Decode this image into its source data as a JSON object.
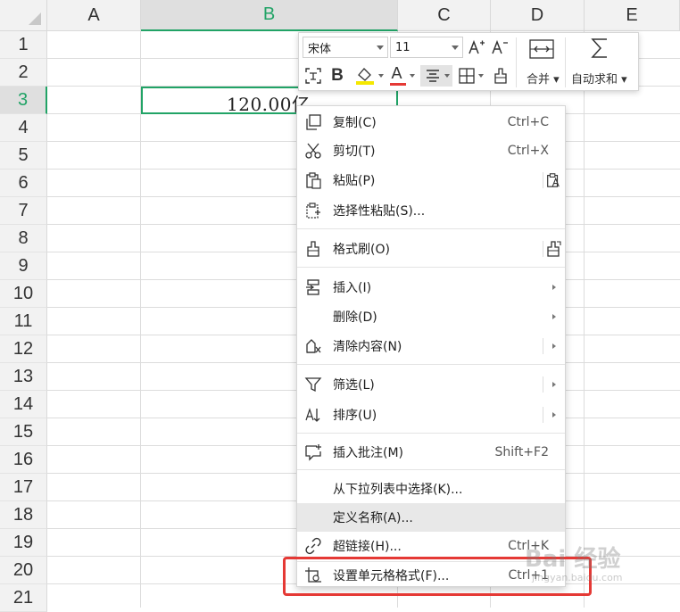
{
  "columns": [
    "A",
    "B",
    "C",
    "D",
    "E"
  ],
  "rows": [
    "1",
    "2",
    "3",
    "4",
    "5",
    "6",
    "7",
    "8",
    "9",
    "10",
    "11",
    "12",
    "13",
    "14",
    "15",
    "16",
    "17",
    "18",
    "19",
    "20",
    "21"
  ],
  "selected_cell": {
    "column": "B",
    "row": "3",
    "value": "120.00亿"
  },
  "mini_toolbar": {
    "font_name": "宋体",
    "font_size": "11",
    "grow_font": "A⁺",
    "shrink_font": "A⁻",
    "merge_label": "合并",
    "autosum_label": "自动求和",
    "bold_label": "B",
    "font_color_label": "A",
    "font_color": "#e53935",
    "fill_color": "#f5e800"
  },
  "context_menu": {
    "items": [
      {
        "label": "复制(C)",
        "shortcut": "Ctrl+C",
        "icon": "copy-icon"
      },
      {
        "label": "剪切(T)",
        "shortcut": "Ctrl+X",
        "icon": "scissors-icon"
      },
      {
        "label": "粘贴(P)",
        "shortcut": "",
        "icon": "paste-icon"
      },
      {
        "label": "选择性粘贴(S)...",
        "shortcut": "",
        "icon": "paste-special-icon"
      },
      {
        "label": "格式刷(O)",
        "shortcut": "",
        "icon": "format-painter-icon"
      },
      {
        "label": "插入(I)",
        "shortcut": "",
        "icon": "insert-icon"
      },
      {
        "label": "删除(D)",
        "shortcut": "",
        "icon": ""
      },
      {
        "label": "清除内容(N)",
        "shortcut": "",
        "icon": "eraser-icon"
      },
      {
        "label": "筛选(L)",
        "shortcut": "",
        "icon": "filter-icon"
      },
      {
        "label": "排序(U)",
        "shortcut": "",
        "icon": "sort-icon"
      },
      {
        "label": "插入批注(M)",
        "shortcut": "Shift+F2",
        "icon": "comment-icon"
      },
      {
        "label": "从下拉列表中选择(K)...",
        "shortcut": "",
        "icon": ""
      },
      {
        "label": "定义名称(A)...",
        "shortcut": "",
        "icon": ""
      },
      {
        "label": "超链接(H)...",
        "shortcut": "Ctrl+K",
        "icon": "link-icon"
      },
      {
        "label": "设置单元格格式(F)...",
        "shortcut": "Ctrl+1",
        "icon": "format-cells-icon"
      }
    ]
  },
  "watermark": {
    "text": "Bai 经验",
    "sub": "jingyan.baidu.com"
  },
  "colors": {
    "accent": "#21a366",
    "highlight_box": "#e53935",
    "hover_row": "#e8e8e8"
  }
}
